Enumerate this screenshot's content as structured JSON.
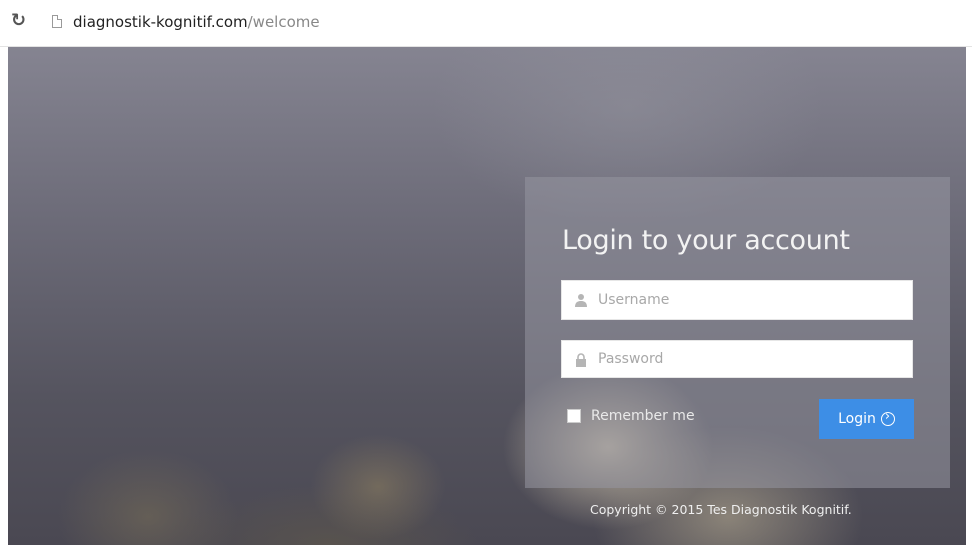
{
  "browser": {
    "url_domain": "diagnostik-kognitif.com",
    "url_path": "/welcome",
    "reload_icon": "reload-icon",
    "page_icon": "page-icon"
  },
  "login": {
    "title": "Login to your account",
    "username_placeholder": "Username",
    "password_placeholder": "Password",
    "remember_label": "Remember me",
    "remember_checked": false,
    "login_button_label": "Login",
    "username_icon": "user-icon",
    "password_icon": "lock-icon",
    "button_icon": "arrow-circle-right-icon"
  },
  "footer": {
    "copyright": "Copyright © 2015 Tes Diagnostik Kognitif."
  },
  "colors": {
    "button": "#3d8ee6",
    "panel": "rgba(150,150,160,0.55)",
    "background_dark": "#4a4852"
  }
}
